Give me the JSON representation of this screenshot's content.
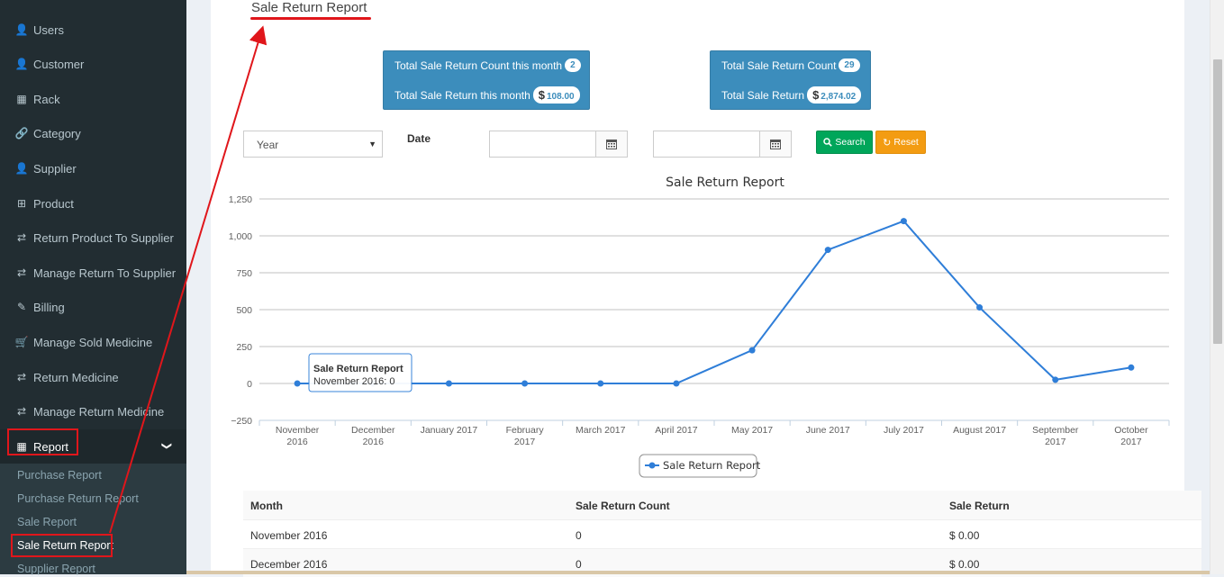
{
  "sidebar": {
    "items": [
      {
        "label": "Users",
        "icon": "user-icon",
        "glyph": "👤"
      },
      {
        "label": "Customer",
        "icon": "user-icon",
        "glyph": "👤"
      },
      {
        "label": "Rack",
        "icon": "table-icon",
        "glyph": "▦"
      },
      {
        "label": "Category",
        "icon": "link-icon",
        "glyph": "🔗"
      },
      {
        "label": "Supplier",
        "icon": "user-icon",
        "glyph": "👤"
      },
      {
        "label": "Product",
        "icon": "medkit-icon",
        "glyph": "⊞"
      },
      {
        "label": "Return Product To Supplier",
        "icon": "exchange-icon",
        "glyph": "⇄"
      },
      {
        "label": "Manage Return To Supplier",
        "icon": "exchange-icon",
        "glyph": "⇄"
      },
      {
        "label": "Billing",
        "icon": "billing-icon",
        "glyph": "✎"
      },
      {
        "label": "Manage Sold Medicine",
        "icon": "cart-icon",
        "glyph": "🛒"
      },
      {
        "label": "Return Medicine",
        "icon": "exchange-icon",
        "glyph": "⇄"
      },
      {
        "label": "Manage Return Medicine",
        "icon": "exchange-icon",
        "glyph": "⇄"
      },
      {
        "label": "Report",
        "icon": "table-icon",
        "glyph": "▦"
      }
    ],
    "report_chevron": "❯",
    "submenu": [
      "Purchase Report",
      "Purchase Return Report",
      "Sale Report",
      "Sale Return Report",
      "Supplier Report"
    ]
  },
  "page": {
    "title": "Sale Return Report"
  },
  "stats": {
    "month_count_label": "Total Sale Return Count this month",
    "month_count_value": "2",
    "month_amount_label": "Total Sale Return this month",
    "month_amount_value": "108.00",
    "total_count_label": "Total Sale Return Count",
    "total_count_value": "29",
    "total_amount_label": "Total Sale Return",
    "total_amount_value": "2,874.02",
    "currency": "$"
  },
  "filters": {
    "period_select": "Year",
    "date_label": "Date",
    "search_label": "Search",
    "reset_label": "Reset"
  },
  "chart_data": {
    "type": "line",
    "title": "Sale Return Report",
    "xlabel": "",
    "ylabel": "",
    "ylim": [
      -250,
      1250
    ],
    "yticks": [
      -250,
      0,
      250,
      500,
      750,
      1000,
      1250
    ],
    "ytick_labels": [
      "−250",
      "0",
      "250",
      "500",
      "750",
      "1,000",
      "1,250"
    ],
    "categories": [
      "November 2016",
      "December 2016",
      "January 2017",
      "February 2017",
      "March 2017",
      "April 2017",
      "May 2017",
      "June 2017",
      "July 2017",
      "August 2017",
      "September 2017",
      "October 2017"
    ],
    "series": [
      {
        "name": "Sale Return Report",
        "values": [
          0,
          0,
          0,
          0,
          0,
          0,
          225,
          905,
          1100,
          515,
          25,
          108
        ]
      }
    ],
    "grid": true,
    "legend": "bottom-center",
    "tooltip": {
      "title": "Sale Return Report",
      "text": "November 2016: 0"
    },
    "colors": {
      "series": "#2f7ed8",
      "grid": "#c0c0c0",
      "axis": "#c0d0e0"
    }
  },
  "table": {
    "headers": [
      "Month",
      "Sale Return Count",
      "Sale Return"
    ],
    "rows": [
      [
        "November 2016",
        "0",
        "$ 0.00"
      ],
      [
        "December 2016",
        "0",
        "$ 0.00"
      ]
    ]
  },
  "colors": {
    "sidebar_bg": "#222d32",
    "primary": "#3c8dbc",
    "success": "#00a65a",
    "warning": "#f39c12",
    "annotation": "#e0161b"
  }
}
